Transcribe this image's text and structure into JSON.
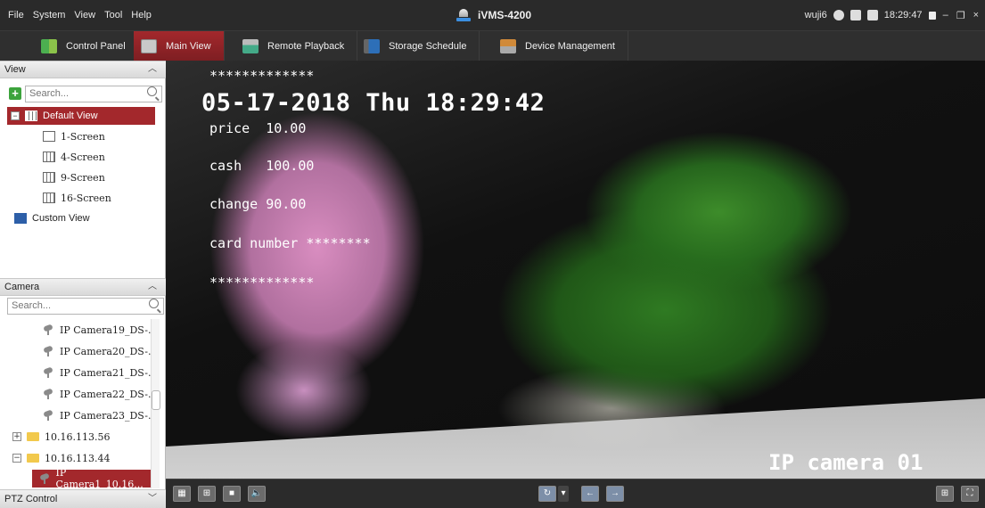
{
  "menubar": {
    "menus": [
      "File",
      "System",
      "View",
      "Tool",
      "Help"
    ],
    "app_title": "iVMS-4200",
    "user": "wuji6",
    "clock": "18:29:47"
  },
  "tabs": [
    {
      "label": "Control Panel",
      "icon": "control-panel-icon"
    },
    {
      "label": "Main View",
      "icon": "main-view-icon",
      "active": true
    },
    {
      "label": "Remote Playback",
      "icon": "remote-playback-icon"
    },
    {
      "label": "Storage Schedule",
      "icon": "storage-schedule-icon"
    },
    {
      "label": "Device Management",
      "icon": "device-management-icon"
    }
  ],
  "view_panel": {
    "title": "View",
    "search_placeholder": "Search...",
    "items": [
      {
        "label": "Default View",
        "selected": true
      },
      {
        "label": "1-Screen"
      },
      {
        "label": "4-Screen"
      },
      {
        "label": "9-Screen"
      },
      {
        "label": "16-Screen"
      },
      {
        "label": "Custom View"
      }
    ]
  },
  "camera_panel": {
    "title": "Camera",
    "search_placeholder": "Search...",
    "items": [
      {
        "label": "IP Camera19_DS-..."
      },
      {
        "label": "IP Camera20_DS-..."
      },
      {
        "label": "IP Camera21_DS-..."
      },
      {
        "label": "IP Camera22_DS-..."
      },
      {
        "label": "IP Camera23_DS-..."
      },
      {
        "label": "10.16.113.56"
      },
      {
        "label": "10.16.113.44"
      },
      {
        "label": "IP Camera1_10.16...",
        "selected": true
      }
    ]
  },
  "ptz": {
    "title": "PTZ Control"
  },
  "video": {
    "osd_stars_top": "*************",
    "osd_datetime": "05-17-2018 Thu 18:29:42",
    "osd_price": "price  10.00",
    "osd_cash": "cash   100.00",
    "osd_change": "change 90.00",
    "osd_card": "card number ********",
    "osd_stars_bottom": "*************",
    "camera_name": "IP camera 01"
  },
  "colors": {
    "accent": "#a3282c",
    "menubar_bg": "#2a2a2a",
    "panel_bg": "#ffffff"
  }
}
